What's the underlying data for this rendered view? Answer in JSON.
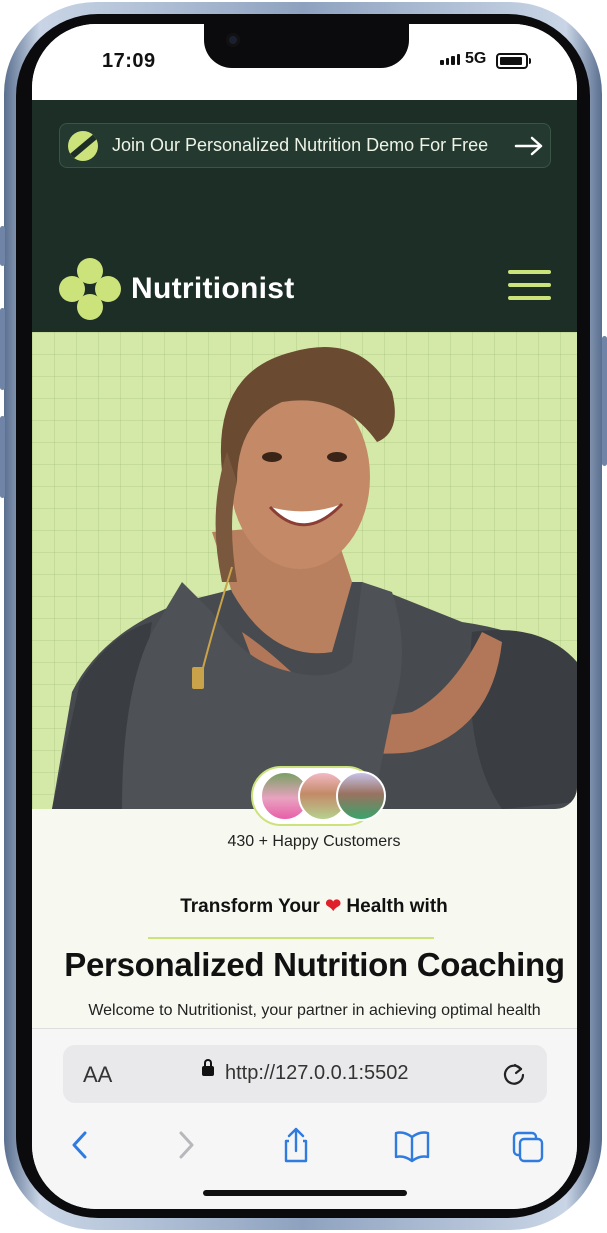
{
  "status_bar": {
    "time": "17:09",
    "network": "5G"
  },
  "promo": {
    "text": "Join Our Personalized Nutrition Demo For Free"
  },
  "brand": {
    "name": "Nutritionist"
  },
  "hero": {
    "customers": "430 + Happy Customers"
  },
  "intro": {
    "subheading_before": "Transform Your",
    "subheading_after": "Health with",
    "title": "Personalized Nutrition Coaching",
    "body": "Welcome to Nutritionist, your partner in achieving optimal health"
  },
  "browser": {
    "text_size_label": "AA",
    "url": "http://127.0.0.1:5502"
  },
  "icons": [
    "chevron-left-icon",
    "chevron-right-icon",
    "share-icon",
    "bookmarks-icon",
    "tabs-icon",
    "reload-icon",
    "lock-icon",
    "menu-icon",
    "arrow-right-icon",
    "heart-icon"
  ],
  "colors": {
    "brand_dark": "#1d2e27",
    "accent_lime": "#cbe37a",
    "hero_bg": "#d4e8a7",
    "link_blue": "#2f7be0"
  }
}
